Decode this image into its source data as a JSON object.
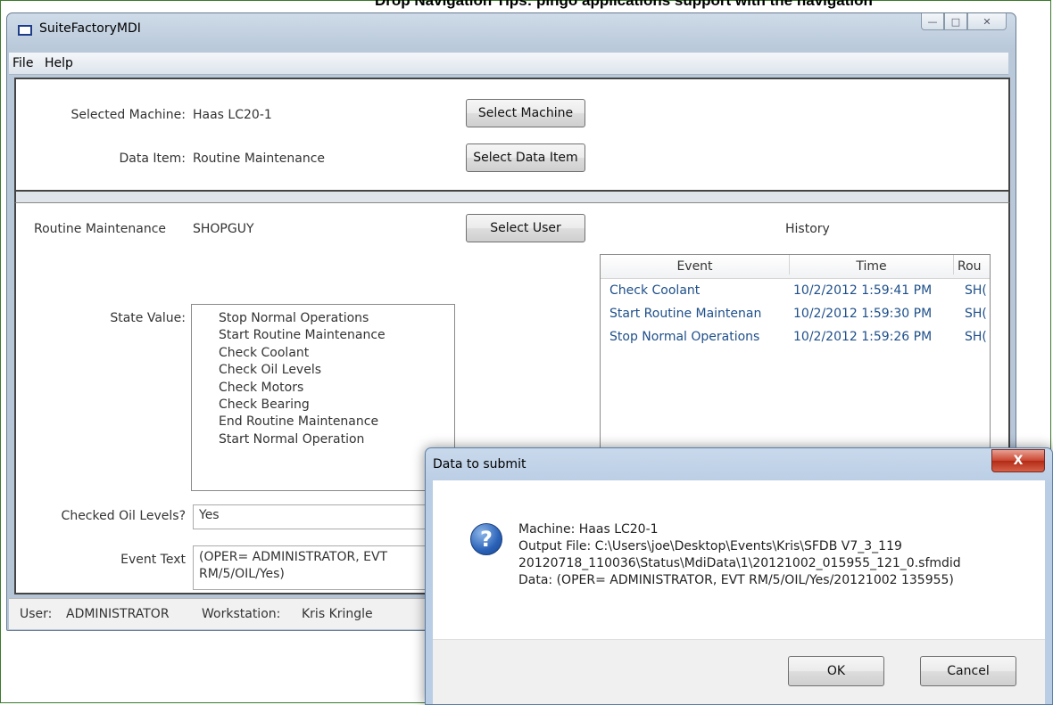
{
  "page_caption": "Drop Navigation Tips: pingo applications support with the navigation",
  "window": {
    "title": "SuiteFactoryMDI",
    "controls": {
      "minimize": "—",
      "maximize": "□",
      "close": "✕"
    }
  },
  "menu": [
    "File",
    "Help"
  ],
  "top_panel": {
    "selected_machine_label": "Selected Machine:",
    "selected_machine_value": "Haas LC20-1",
    "select_machine_button": "Select Machine",
    "data_item_label": "Data Item:",
    "data_item_value": "Routine Maintenance",
    "select_data_item_button": "Select Data Item"
  },
  "main_panel": {
    "routine_label": "Routine Maintenance",
    "routine_user": "SHOPGUY",
    "select_user_button": "Select User",
    "state_value_label": "State Value:",
    "state_values": [
      "Stop Normal Operations",
      "Start Routine Maintenance",
      "Check Coolant",
      "Check Oil Levels",
      "Check Motors",
      "Check Bearing",
      "End Routine Maintenance",
      "Start Normal Operation"
    ],
    "checked_oil_label": "Checked Oil Levels?",
    "checked_oil_value": "Yes",
    "event_text_label": "Event Text",
    "event_text_line1": "(OPER= ADMINISTRATOR, EVT",
    "event_text_line2": "RM/5/OIL/Yes)"
  },
  "history": {
    "title": "History",
    "columns": [
      "Event",
      "Time",
      "Rou"
    ],
    "rows": [
      [
        "Check Coolant",
        "10/2/2012 1:59:41 PM",
        "SH("
      ],
      [
        "Start Routine Maintenan",
        "10/2/2012 1:59:30 PM",
        "SH("
      ],
      [
        "Stop Normal Operations",
        "10/2/2012 1:59:26 PM",
        "SH("
      ]
    ]
  },
  "status_bar": {
    "user_label": "User:",
    "user_value": "ADMINISTRATOR",
    "workstation_label": "Workstation:",
    "workstation_value": "Kris Kringle"
  },
  "dialog": {
    "title": "Data to submit",
    "close": "X",
    "icon": "question-icon",
    "lines": [
      "Machine: Haas LC20-1",
      "Output File: C:\\Users\\joe\\Desktop\\Events\\Kris\\SFDB V7_3_119",
      "20120718_110036\\Status\\MdiData\\1\\20121002_015955_121_0.sfmdid",
      "Data: (OPER= ADMINISTRATOR, EVT RM/5/OIL/Yes/20121002 135955)"
    ],
    "ok_button": "OK",
    "cancel_button": "Cancel"
  }
}
